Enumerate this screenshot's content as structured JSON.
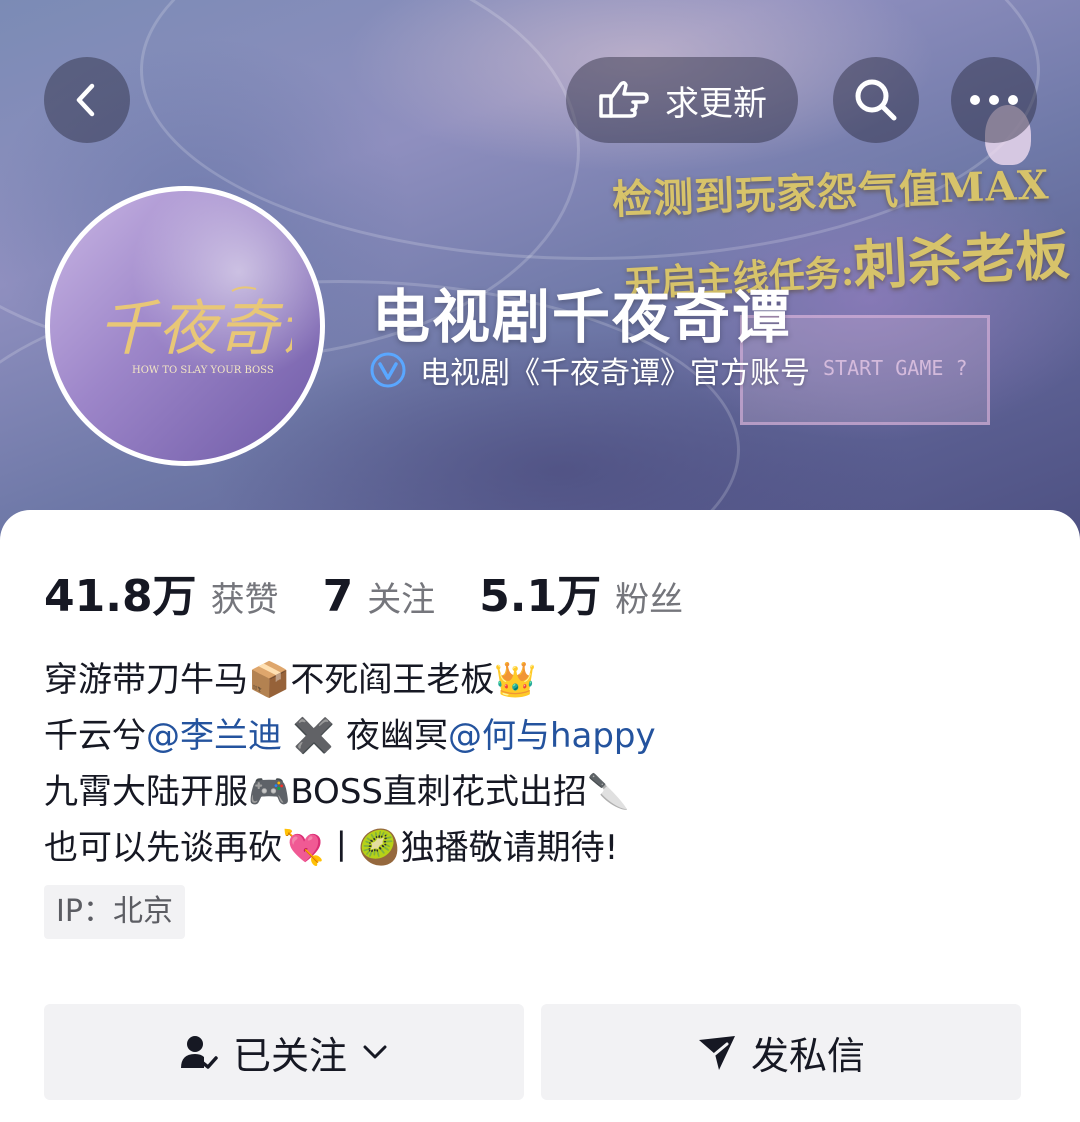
{
  "header": {
    "request_update_label": "求更新"
  },
  "banner": {
    "headline_line1": "检测到玩家怨气值MAX",
    "headline_line2_prefix": "开启主线任务:",
    "headline_line2_emphasis": "刺杀老板",
    "game_box_text": "START GAME ?"
  },
  "avatar": {
    "logo_text": "千夜奇谭",
    "logo_subtext": "HOW TO SLAY YOUR BOSS"
  },
  "profile": {
    "name": "电视剧千夜奇谭",
    "verification": "电视剧《千夜奇谭》官方账号"
  },
  "stats": [
    {
      "value": "41.8万",
      "label": "获赞"
    },
    {
      "value": "7",
      "label": "关注"
    },
    {
      "value": "5.1万",
      "label": "粉丝"
    }
  ],
  "bio": {
    "line1": "穿游带刀牛马📦不死阎王老板👑",
    "line2_a": "千云兮",
    "line2_mention1": "@李兰迪",
    "line2_mid": " ✖️ 夜幽冥",
    "line2_mention2": "@何与happy",
    "line3": "九霄大陆开服🎮BOSS直刺花式出招🔪",
    "line4": "也可以先谈再砍💘丨🥝独播敬请期待!"
  },
  "ip": "IP：北京",
  "actions": {
    "follow_label": "已关注",
    "message_label": "发私信"
  },
  "colors": {
    "mention": "#24539e",
    "verify_badge": "#5aa7ff",
    "banner_gold": "#d7c36a"
  }
}
